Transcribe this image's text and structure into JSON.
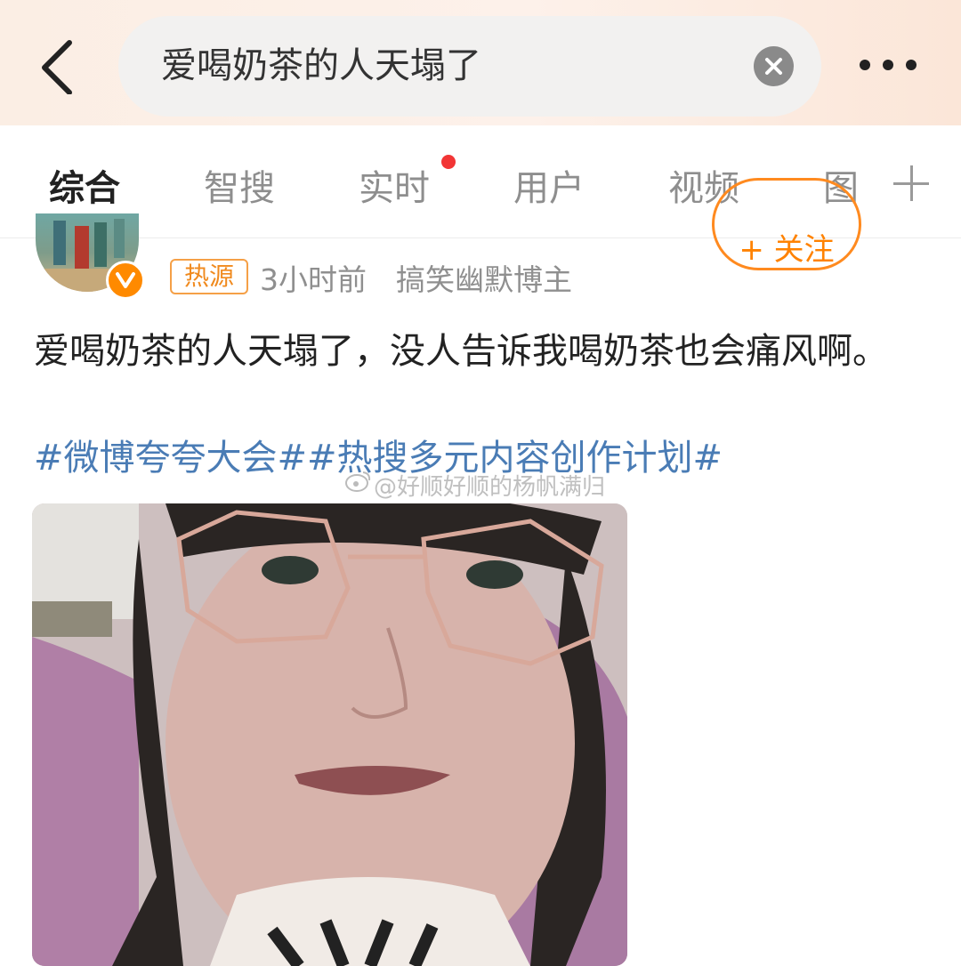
{
  "search": {
    "query": "爱喝奶茶的人天塌了"
  },
  "tabs": [
    {
      "label": "综合",
      "active": true
    },
    {
      "label": "智搜",
      "active": false
    },
    {
      "label": "实时",
      "active": false,
      "has_dot": true
    },
    {
      "label": "用户",
      "active": false
    },
    {
      "label": "视频",
      "active": false
    },
    {
      "label": "图",
      "active": false
    }
  ],
  "post": {
    "badge": "热源",
    "time": "3小时前",
    "author_desc": "搞笑幽默博主",
    "follow_label": "+ 关注",
    "text": "爱喝奶茶的人天塌了，没人告诉我喝奶茶也会痛风啊。",
    "hashtags": [
      "#微博夸夸大会#",
      "#热搜多元内容创作计划#"
    ],
    "watermark": "@好顺好顺的杨帆满归"
  },
  "colors": {
    "accent": "#ff8200",
    "link": "#4a7cb5",
    "dot": "#f23535"
  },
  "icons": {
    "back": "chevron-left-icon",
    "clear": "close-icon",
    "more": "more-dots-icon",
    "add": "plus-icon",
    "verified": "verified-v-icon"
  }
}
